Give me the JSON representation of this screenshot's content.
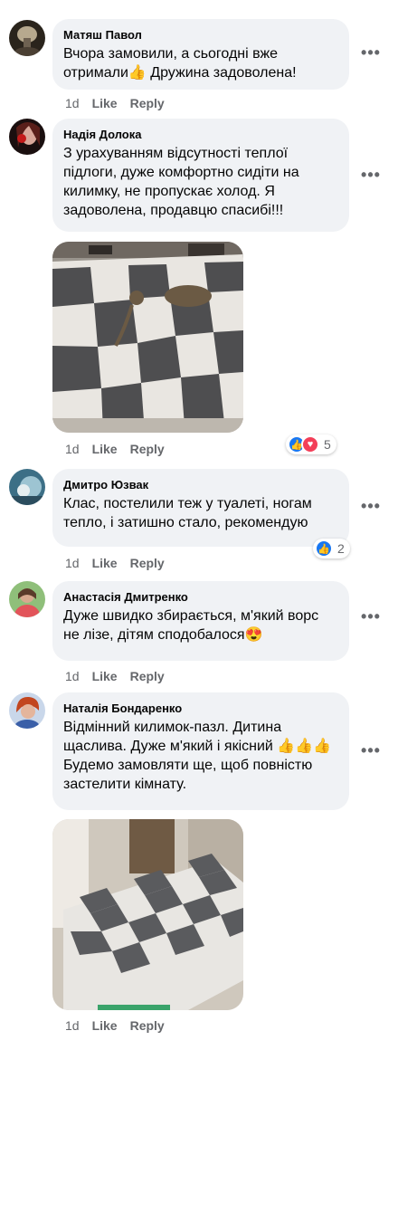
{
  "comments": [
    {
      "author": "Матяш Павол",
      "text": "Вчора замовили, а сьогодні вже отримали👍 Дружина задоволена!",
      "time": "1d",
      "like": "Like",
      "reply": "Reply"
    },
    {
      "author": "Надія Долока",
      "text": "З урахуванням відсутності теплої підлоги, дуже комфортно сидіти на килимку, не пропускає холод. Я задоволена, продавцю спасибі!!!",
      "time": "1d",
      "like": "Like",
      "reply": "Reply",
      "reactions": "5"
    },
    {
      "author": "Дмитро Юзвак",
      "text": "Клас, постелили теж у туалеті, ногам тепло, і затишно стало, рекомендую",
      "time": "1d",
      "like": "Like",
      "reply": "Reply",
      "reactions": "2"
    },
    {
      "author": "Анастасія Дмитренко",
      "text": "Дуже швидко збирається, м'який ворс не лізе, дітям сподобалося😍",
      "time": "1d",
      "like": "Like",
      "reply": "Reply"
    },
    {
      "author": "Наталія Бондаренко",
      "text": "Відмінний килимок-пазл. Дитина щаслива. Дуже м'який і якісний 👍👍👍 Будемо замовляти ще, щоб повністю застелити кімнату.",
      "time": "1d",
      "like": "Like",
      "reply": "Reply"
    }
  ],
  "icons": {
    "more": "more-dots-icon",
    "like": "like-reaction-icon",
    "love": "love-reaction-icon"
  },
  "colors": {
    "bubble": "#f0f2f5",
    "meta": "#65676b",
    "like": "#1877f2",
    "love": "#f33e58"
  }
}
